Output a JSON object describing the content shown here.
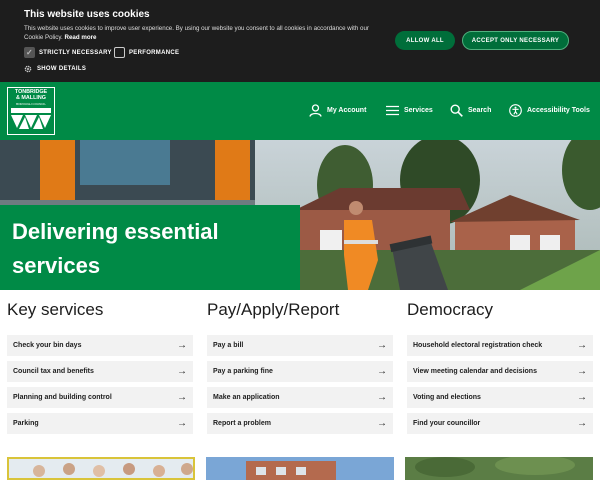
{
  "cookie": {
    "title": "This website uses cookies",
    "text": "This website uses cookies to improve user experience. By using our website you consent to all cookies in accordance with our Cookie Policy.",
    "read_more": "Read more",
    "strictly_necessary": "STRICTLY NECESSARY",
    "performance": "PERFORMANCE",
    "show_details": "SHOW DETAILS",
    "allow_all": "ALLOW ALL",
    "accept_essential": "ACCEPT ONLY NECESSARY"
  },
  "header": {
    "logo_line1": "TONBRIDGE",
    "logo_line2": "& MALLING",
    "logo_line3": "BOROUGH COUNCIL",
    "my_account": "My Account",
    "services": "Services",
    "search": "Search",
    "accessibility": "Accessibility Tools"
  },
  "hero": {
    "title_line1": "Delivering essential",
    "title_line2": "services"
  },
  "columns": [
    {
      "heading": "Key services",
      "links": [
        "Check your bin days",
        "Council tax and benefits",
        "Planning and building control",
        "Parking"
      ]
    },
    {
      "heading": "Pay/Apply/Report",
      "links": [
        "Pay a bill",
        "Pay a parking fine",
        "Make an application",
        "Report a problem"
      ]
    },
    {
      "heading": "Democracy",
      "links": [
        "Household electoral registration check",
        "View meeting calendar and decisions",
        "Voting and elections",
        "Find your councillor"
      ]
    }
  ],
  "colors": {
    "green": "#008a46",
    "dark": "#1d1d1d",
    "button_green": "#006e3a"
  }
}
